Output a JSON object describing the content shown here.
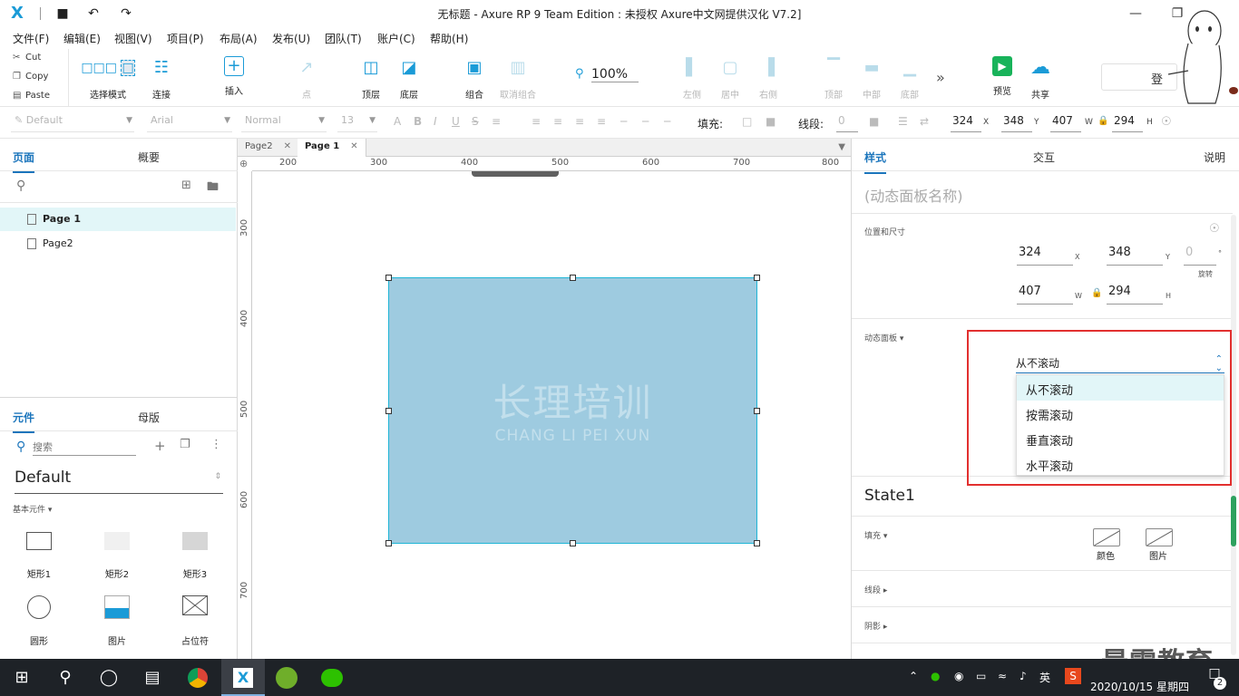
{
  "window": {
    "title": "无标题 - Axure RP 9 Team Edition : 未授权     Axure中文网提供汉化 V7.2]",
    "app_logo": "X"
  },
  "menu": [
    "文件(F)",
    "编辑(E)",
    "视图(V)",
    "项目(P)",
    "布局(A)",
    "发布(U)",
    "团队(T)",
    "账户(C)",
    "帮助(H)"
  ],
  "clipboard": {
    "cut": "Cut",
    "copy": "Copy",
    "paste": "Paste"
  },
  "toolbar": {
    "select_mode": "选择模式",
    "connect": "连接",
    "insert": "插入",
    "point": "点",
    "top_layer": "顶层",
    "bottom_layer": "底层",
    "group": "组合",
    "ungroup": "取消组合",
    "zoom": "100%",
    "align_left": "左侧",
    "align_center": "居中",
    "align_right": "右侧",
    "align_top": "顶部",
    "align_middle": "中部",
    "align_bottom": "底部",
    "preview": "预览",
    "share": "共享",
    "login": "登"
  },
  "format": {
    "style": "Default",
    "font": "Arial",
    "weight": "Normal",
    "size": "13",
    "fill_label": "填充:",
    "stroke_label": "线段:",
    "stroke_value": "0",
    "x": "324",
    "y": "348",
    "w": "407",
    "h": "294",
    "x_label": "X",
    "y_label": "Y",
    "w_label": "W",
    "h_label": "H"
  },
  "pages_panel": {
    "tab_pages": "页面",
    "tab_outline": "概要",
    "pages": [
      "Page 1",
      "Page2"
    ]
  },
  "library_panel": {
    "tab_widgets": "元件",
    "tab_masters": "母版",
    "search_placeholder": "搜索",
    "library": "Default",
    "section": "基本元件 ▾",
    "widgets": [
      "矩形1",
      "矩形2",
      "矩形3",
      "圆形",
      "图片",
      "占位符"
    ]
  },
  "canvas": {
    "tabs": [
      "Page2",
      "Page 1"
    ],
    "ruler_h": [
      "200",
      "300",
      "400",
      "500",
      "600",
      "700",
      "800"
    ],
    "ruler_v": [
      "300",
      "400",
      "500",
      "600",
      "700"
    ],
    "watermark_cn": "长理培训",
    "watermark_en": "CHANG LI PEI XUN"
  },
  "inspector": {
    "tab_style": "样式",
    "tab_interact": "交互",
    "tab_notes": "说明",
    "name_placeholder": "(动态面板名称)",
    "pos_size_label": "位置和尺寸",
    "x": "324",
    "y": "348",
    "rotation": "0",
    "rotation_label": "旋转",
    "deg": "°",
    "w": "407",
    "h": "294",
    "x_label": "X",
    "y_label": "Y",
    "w_label": "W",
    "h_label": "H",
    "dynamic_panel_label": "动态面板 ▾",
    "scroll_current": "从不滚动",
    "scroll_options": [
      "从不滚动",
      "按需滚动",
      "垂直滚动",
      "水平滚动"
    ],
    "state_title": "State1",
    "fill_label": "填充 ▾",
    "fill_color": "颜色",
    "fill_image": "图片",
    "stroke_label": "线段 ▸",
    "shadow_label": "阴影 ▸"
  },
  "taskbar": {
    "ime": "英",
    "date": "2020/10/15 星期四",
    "notifications": "2"
  },
  "brand_watermark": "最需教育",
  "colors": {
    "accent": "#1b75bc",
    "panel_fill": "#9ecbe0",
    "highlight": "#e2302f",
    "taskbar": "#1e2227"
  }
}
